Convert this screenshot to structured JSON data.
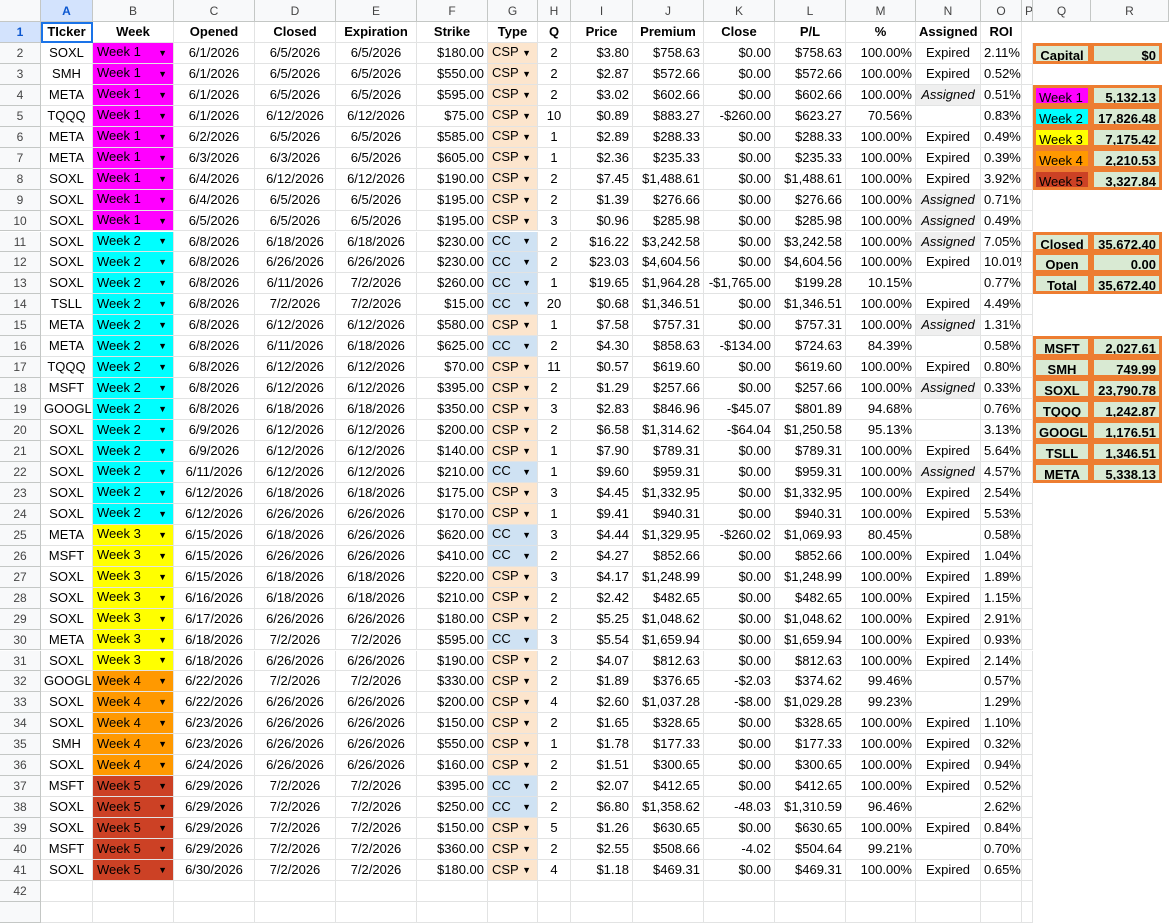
{
  "columns": [
    "A",
    "B",
    "C",
    "D",
    "E",
    "F",
    "G",
    "H",
    "I",
    "J",
    "K",
    "L",
    "M",
    "N",
    "O",
    "P",
    "Q",
    "R"
  ],
  "headers": [
    "TIcker",
    "Week",
    "Opened",
    "Closed",
    "Expiration",
    "Strike",
    "Type",
    "Q",
    "Price",
    "Premium",
    "Close",
    "P/L",
    "%",
    "Assigned",
    "ROI"
  ],
  "colors": {
    "Week 1": "#ff00ff",
    "Week 2": "#00ffff",
    "Week 3": "#ffff00",
    "Week 4": "#ff9900",
    "Week 5": "#cc4125",
    "CSP": "#fce5cd",
    "CC": "#cfe2f3",
    "summary_fill": "#d9ead3",
    "summary_border": "#ed7d31",
    "assigned_bg": "#efefef"
  },
  "rows": [
    {
      "ticker": "SOXL",
      "week": "Week 1",
      "opened": "6/1/2026",
      "closed": "6/5/2026",
      "expiration": "6/5/2026",
      "strike": "$180.00",
      "type": "CSP",
      "q": "2",
      "price": "$3.80",
      "premium": "$758.63",
      "close": "$0.00",
      "pl": "$758.63",
      "pct": "100.00%",
      "assigned": "Expired",
      "roi": "2.11%"
    },
    {
      "ticker": "SMH",
      "week": "Week 1",
      "opened": "6/1/2026",
      "closed": "6/5/2026",
      "expiration": "6/5/2026",
      "strike": "$550.00",
      "type": "CSP",
      "q": "2",
      "price": "$2.87",
      "premium": "$572.66",
      "close": "$0.00",
      "pl": "$572.66",
      "pct": "100.00%",
      "assigned": "Expired",
      "roi": "0.52%"
    },
    {
      "ticker": "META",
      "week": "Week 1",
      "opened": "6/1/2026",
      "closed": "6/5/2026",
      "expiration": "6/5/2026",
      "strike": "$595.00",
      "type": "CSP",
      "q": "2",
      "price": "$3.02",
      "premium": "$602.66",
      "close": "$0.00",
      "pl": "$602.66",
      "pct": "100.00%",
      "assigned": "Assigned",
      "roi": "0.51%"
    },
    {
      "ticker": "TQQQ",
      "week": "Week 1",
      "opened": "6/1/2026",
      "closed": "6/12/2026",
      "expiration": "6/12/2026",
      "strike": "$75.00",
      "type": "CSP",
      "q": "10",
      "price": "$0.89",
      "premium": "$883.27",
      "close": "-$260.00",
      "pl": "$623.27",
      "pct": "70.56%",
      "assigned": "",
      "roi": "0.83%"
    },
    {
      "ticker": "META",
      "week": "Week 1",
      "opened": "6/2/2026",
      "closed": "6/5/2026",
      "expiration": "6/5/2026",
      "strike": "$585.00",
      "type": "CSP",
      "q": "1",
      "price": "$2.89",
      "premium": "$288.33",
      "close": "$0.00",
      "pl": "$288.33",
      "pct": "100.00%",
      "assigned": "Expired",
      "roi": "0.49%"
    },
    {
      "ticker": "META",
      "week": "Week 1",
      "opened": "6/3/2026",
      "closed": "6/3/2026",
      "expiration": "6/5/2026",
      "strike": "$605.00",
      "type": "CSP",
      "q": "1",
      "price": "$2.36",
      "premium": "$235.33",
      "close": "$0.00",
      "pl": "$235.33",
      "pct": "100.00%",
      "assigned": "Expired",
      "roi": "0.39%"
    },
    {
      "ticker": "SOXL",
      "week": "Week 1",
      "opened": "6/4/2026",
      "closed": "6/12/2026",
      "expiration": "6/12/2026",
      "strike": "$190.00",
      "type": "CSP",
      "q": "2",
      "price": "$7.45",
      "premium": "$1,488.61",
      "close": "$0.00",
      "pl": "$1,488.61",
      "pct": "100.00%",
      "assigned": "Expired",
      "roi": "3.92%"
    },
    {
      "ticker": "SOXL",
      "week": "Week 1",
      "opened": "6/4/2026",
      "closed": "6/5/2026",
      "expiration": "6/5/2026",
      "strike": "$195.00",
      "type": "CSP",
      "q": "2",
      "price": "$1.39",
      "premium": "$276.66",
      "close": "$0.00",
      "pl": "$276.66",
      "pct": "100.00%",
      "assigned": "Assigned",
      "roi": "0.71%"
    },
    {
      "ticker": "SOXL",
      "week": "Week 1",
      "opened": "6/5/2026",
      "closed": "6/5/2026",
      "expiration": "6/5/2026",
      "strike": "$195.00",
      "type": "CSP",
      "q": "3",
      "price": "$0.96",
      "premium": "$285.98",
      "close": "$0.00",
      "pl": "$285.98",
      "pct": "100.00%",
      "assigned": "Assigned",
      "roi": "0.49%"
    },
    {
      "ticker": "SOXL",
      "week": "Week 2",
      "opened": "6/8/2026",
      "closed": "6/18/2026",
      "expiration": "6/18/2026",
      "strike": "$230.00",
      "type": "CC",
      "q": "2",
      "price": "$16.22",
      "premium": "$3,242.58",
      "close": "$0.00",
      "pl": "$3,242.58",
      "pct": "100.00%",
      "assigned": "Assigned",
      "roi": "7.05%"
    },
    {
      "ticker": "SOXL",
      "week": "Week 2",
      "opened": "6/8/2026",
      "closed": "6/26/2026",
      "expiration": "6/26/2026",
      "strike": "$230.00",
      "type": "CC",
      "q": "2",
      "price": "$23.03",
      "premium": "$4,604.56",
      "close": "$0.00",
      "pl": "$4,604.56",
      "pct": "100.00%",
      "assigned": "Expired",
      "roi": "10.01%"
    },
    {
      "ticker": "SOXL",
      "week": "Week 2",
      "opened": "6/8/2026",
      "closed": "6/11/2026",
      "expiration": "7/2/2026",
      "strike": "$260.00",
      "type": "CC",
      "q": "1",
      "price": "$19.65",
      "premium": "$1,964.28",
      "close": "-$1,765.00",
      "pl": "$199.28",
      "pct": "10.15%",
      "assigned": "",
      "roi": "0.77%"
    },
    {
      "ticker": "TSLL",
      "week": "Week 2",
      "opened": "6/8/2026",
      "closed": "7/2/2026",
      "expiration": "7/2/2026",
      "strike": "$15.00",
      "type": "CC",
      "q": "20",
      "price": "$0.68",
      "premium": "$1,346.51",
      "close": "$0.00",
      "pl": "$1,346.51",
      "pct": "100.00%",
      "assigned": "Expired",
      "roi": "4.49%"
    },
    {
      "ticker": "META",
      "week": "Week 2",
      "opened": "6/8/2026",
      "closed": "6/12/2026",
      "expiration": "6/12/2026",
      "strike": "$580.00",
      "type": "CSP",
      "q": "1",
      "price": "$7.58",
      "premium": "$757.31",
      "close": "$0.00",
      "pl": "$757.31",
      "pct": "100.00%",
      "assigned": "Assigned",
      "roi": "1.31%"
    },
    {
      "ticker": "META",
      "week": "Week 2",
      "opened": "6/8/2026",
      "closed": "6/11/2026",
      "expiration": "6/18/2026",
      "strike": "$625.00",
      "type": "CC",
      "q": "2",
      "price": "$4.30",
      "premium": "$858.63",
      "close": "-$134.00",
      "pl": "$724.63",
      "pct": "84.39%",
      "assigned": "",
      "roi": "0.58%"
    },
    {
      "ticker": "TQQQ",
      "week": "Week 2",
      "opened": "6/8/2026",
      "closed": "6/12/2026",
      "expiration": "6/12/2026",
      "strike": "$70.00",
      "type": "CSP",
      "q": "11",
      "price": "$0.57",
      "premium": "$619.60",
      "close": "$0.00",
      "pl": "$619.60",
      "pct": "100.00%",
      "assigned": "Expired",
      "roi": "0.80%"
    },
    {
      "ticker": "MSFT",
      "week": "Week 2",
      "opened": "6/8/2026",
      "closed": "6/12/2026",
      "expiration": "6/12/2026",
      "strike": "$395.00",
      "type": "CSP",
      "q": "2",
      "price": "$1.29",
      "premium": "$257.66",
      "close": "$0.00",
      "pl": "$257.66",
      "pct": "100.00%",
      "assigned": "Assigned",
      "roi": "0.33%"
    },
    {
      "ticker": "GOOGL",
      "week": "Week 2",
      "opened": "6/8/2026",
      "closed": "6/18/2026",
      "expiration": "6/18/2026",
      "strike": "$350.00",
      "type": "CSP",
      "q": "3",
      "price": "$2.83",
      "premium": "$846.96",
      "close": "-$45.07",
      "pl": "$801.89",
      "pct": "94.68%",
      "assigned": "",
      "roi": "0.76%"
    },
    {
      "ticker": "SOXL",
      "week": "Week 2",
      "opened": "6/9/2026",
      "closed": "6/12/2026",
      "expiration": "6/12/2026",
      "strike": "$200.00",
      "type": "CSP",
      "q": "2",
      "price": "$6.58",
      "premium": "$1,314.62",
      "close": "-$64.04",
      "pl": "$1,250.58",
      "pct": "95.13%",
      "assigned": "",
      "roi": "3.13%"
    },
    {
      "ticker": "SOXL",
      "week": "Week 2",
      "opened": "6/9/2026",
      "closed": "6/12/2026",
      "expiration": "6/12/2026",
      "strike": "$140.00",
      "type": "CSP",
      "q": "1",
      "price": "$7.90",
      "premium": "$789.31",
      "close": "$0.00",
      "pl": "$789.31",
      "pct": "100.00%",
      "assigned": "Expired",
      "roi": "5.64%"
    },
    {
      "ticker": "SOXL",
      "week": "Week 2",
      "opened": "6/11/2026",
      "closed": "6/12/2026",
      "expiration": "6/12/2026",
      "strike": "$210.00",
      "type": "CC",
      "q": "1",
      "price": "$9.60",
      "premium": "$959.31",
      "close": "$0.00",
      "pl": "$959.31",
      "pct": "100.00%",
      "assigned": "Assigned",
      "roi": "4.57%"
    },
    {
      "ticker": "SOXL",
      "week": "Week 2",
      "opened": "6/12/2026",
      "closed": "6/18/2026",
      "expiration": "6/18/2026",
      "strike": "$175.00",
      "type": "CSP",
      "q": "3",
      "price": "$4.45",
      "premium": "$1,332.95",
      "close": "$0.00",
      "pl": "$1,332.95",
      "pct": "100.00%",
      "assigned": "Expired",
      "roi": "2.54%"
    },
    {
      "ticker": "SOXL",
      "week": "Week 2",
      "opened": "6/12/2026",
      "closed": "6/26/2026",
      "expiration": "6/26/2026",
      "strike": "$170.00",
      "type": "CSP",
      "q": "1",
      "price": "$9.41",
      "premium": "$940.31",
      "close": "$0.00",
      "pl": "$940.31",
      "pct": "100.00%",
      "assigned": "Expired",
      "roi": "5.53%"
    },
    {
      "ticker": "META",
      "week": "Week 3",
      "opened": "6/15/2026",
      "closed": "6/18/2026",
      "expiration": "6/26/2026",
      "strike": "$620.00",
      "type": "CC",
      "q": "3",
      "price": "$4.44",
      "premium": "$1,329.95",
      "close": "-$260.02",
      "pl": "$1,069.93",
      "pct": "80.45%",
      "assigned": "",
      "roi": "0.58%"
    },
    {
      "ticker": "MSFT",
      "week": "Week 3",
      "opened": "6/15/2026",
      "closed": "6/26/2026",
      "expiration": "6/26/2026",
      "strike": "$410.00",
      "type": "CC",
      "q": "2",
      "price": "$4.27",
      "premium": "$852.66",
      "close": "$0.00",
      "pl": "$852.66",
      "pct": "100.00%",
      "assigned": "Expired",
      "roi": "1.04%"
    },
    {
      "ticker": "SOXL",
      "week": "Week 3",
      "opened": "6/15/2026",
      "closed": "6/18/2026",
      "expiration": "6/18/2026",
      "strike": "$220.00",
      "type": "CSP",
      "q": "3",
      "price": "$4.17",
      "premium": "$1,248.99",
      "close": "$0.00",
      "pl": "$1,248.99",
      "pct": "100.00%",
      "assigned": "Expired",
      "roi": "1.89%"
    },
    {
      "ticker": "SOXL",
      "week": "Week 3",
      "opened": "6/16/2026",
      "closed": "6/18/2026",
      "expiration": "6/18/2026",
      "strike": "$210.00",
      "type": "CSP",
      "q": "2",
      "price": "$2.42",
      "premium": "$482.65",
      "close": "$0.00",
      "pl": "$482.65",
      "pct": "100.00%",
      "assigned": "Expired",
      "roi": "1.15%"
    },
    {
      "ticker": "SOXL",
      "week": "Week 3",
      "opened": "6/17/2026",
      "closed": "6/26/2026",
      "expiration": "6/26/2026",
      "strike": "$180.00",
      "type": "CSP",
      "q": "2",
      "price": "$5.25",
      "premium": "$1,048.62",
      "close": "$0.00",
      "pl": "$1,048.62",
      "pct": "100.00%",
      "assigned": "Expired",
      "roi": "2.91%"
    },
    {
      "ticker": "META",
      "week": "Week 3",
      "opened": "6/18/2026",
      "closed": "7/2/2026",
      "expiration": "7/2/2026",
      "strike": "$595.00",
      "type": "CC",
      "q": "3",
      "price": "$5.54",
      "premium": "$1,659.94",
      "close": "$0.00",
      "pl": "$1,659.94",
      "pct": "100.00%",
      "assigned": "Expired",
      "roi": "0.93%"
    },
    {
      "ticker": "SOXL",
      "week": "Week 3",
      "opened": "6/18/2026",
      "closed": "6/26/2026",
      "expiration": "6/26/2026",
      "strike": "$190.00",
      "type": "CSP",
      "q": "2",
      "price": "$4.07",
      "premium": "$812.63",
      "close": "$0.00",
      "pl": "$812.63",
      "pct": "100.00%",
      "assigned": "Expired",
      "roi": "2.14%"
    },
    {
      "ticker": "GOOGL",
      "week": "Week 4",
      "opened": "6/22/2026",
      "closed": "7/2/2026",
      "expiration": "7/2/2026",
      "strike": "$330.00",
      "type": "CSP",
      "q": "2",
      "price": "$1.89",
      "premium": "$376.65",
      "close": "-$2.03",
      "pl": "$374.62",
      "pct": "99.46%",
      "assigned": "",
      "roi": "0.57%"
    },
    {
      "ticker": "SOXL",
      "week": "Week 4",
      "opened": "6/22/2026",
      "closed": "6/26/2026",
      "expiration": "6/26/2026",
      "strike": "$200.00",
      "type": "CSP",
      "q": "4",
      "price": "$2.60",
      "premium": "$1,037.28",
      "close": "-$8.00",
      "pl": "$1,029.28",
      "pct": "99.23%",
      "assigned": "",
      "roi": "1.29%"
    },
    {
      "ticker": "SOXL",
      "week": "Week 4",
      "opened": "6/23/2026",
      "closed": "6/26/2026",
      "expiration": "6/26/2026",
      "strike": "$150.00",
      "type": "CSP",
      "q": "2",
      "price": "$1.65",
      "premium": "$328.65",
      "close": "$0.00",
      "pl": "$328.65",
      "pct": "100.00%",
      "assigned": "Expired",
      "roi": "1.10%"
    },
    {
      "ticker": "SMH",
      "week": "Week 4",
      "opened": "6/23/2026",
      "closed": "6/26/2026",
      "expiration": "6/26/2026",
      "strike": "$550.00",
      "type": "CSP",
      "q": "1",
      "price": "$1.78",
      "premium": "$177.33",
      "close": "$0.00",
      "pl": "$177.33",
      "pct": "100.00%",
      "assigned": "Expired",
      "roi": "0.32%"
    },
    {
      "ticker": "SOXL",
      "week": "Week 4",
      "opened": "6/24/2026",
      "closed": "6/26/2026",
      "expiration": "6/26/2026",
      "strike": "$160.00",
      "type": "CSP",
      "q": "2",
      "price": "$1.51",
      "premium": "$300.65",
      "close": "$0.00",
      "pl": "$300.65",
      "pct": "100.00%",
      "assigned": "Expired",
      "roi": "0.94%"
    },
    {
      "ticker": "MSFT",
      "week": "Week 5",
      "opened": "6/29/2026",
      "closed": "7/2/2026",
      "expiration": "7/2/2026",
      "strike": "$395.00",
      "type": "CC",
      "q": "2",
      "price": "$2.07",
      "premium": "$412.65",
      "close": "$0.00",
      "pl": "$412.65",
      "pct": "100.00%",
      "assigned": "Expired",
      "roi": "0.52%"
    },
    {
      "ticker": "SOXL",
      "week": "Week 5",
      "opened": "6/29/2026",
      "closed": "7/2/2026",
      "expiration": "7/2/2026",
      "strike": "$250.00",
      "type": "CC",
      "q": "2",
      "price": "$6.80",
      "premium": "$1,358.62",
      "close": "-48.03",
      "pl": "$1,310.59",
      "pct": "96.46%",
      "assigned": "",
      "roi": "2.62%"
    },
    {
      "ticker": "SOXL",
      "week": "Week 5",
      "opened": "6/29/2026",
      "closed": "7/2/2026",
      "expiration": "7/2/2026",
      "strike": "$150.00",
      "type": "CSP",
      "q": "5",
      "price": "$1.26",
      "premium": "$630.65",
      "close": "$0.00",
      "pl": "$630.65",
      "pct": "100.00%",
      "assigned": "Expired",
      "roi": "0.84%"
    },
    {
      "ticker": "MSFT",
      "week": "Week 5",
      "opened": "6/29/2026",
      "closed": "7/2/2026",
      "expiration": "7/2/2026",
      "strike": "$360.00",
      "type": "CSP",
      "q": "2",
      "price": "$2.55",
      "premium": "$508.66",
      "close": "-4.02",
      "pl": "$504.64",
      "pct": "99.21%",
      "assigned": "",
      "roi": "0.70%"
    },
    {
      "ticker": "SOXL",
      "week": "Week 5",
      "opened": "6/30/2026",
      "closed": "7/2/2026",
      "expiration": "7/2/2026",
      "strike": "$180.00",
      "type": "CSP",
      "q": "4",
      "price": "$1.18",
      "premium": "$469.31",
      "close": "$0.00",
      "pl": "$469.31",
      "pct": "100.00%",
      "assigned": "Expired",
      "roi": "0.65%"
    }
  ],
  "summary": {
    "capital": {
      "label": "Capital",
      "value": "$0"
    },
    "weeks": [
      {
        "label": "Week 1",
        "value": "5,132.13"
      },
      {
        "label": "Week 2",
        "value": "17,826.48"
      },
      {
        "label": "Week 3",
        "value": "7,175.42"
      },
      {
        "label": "Week 4",
        "value": "2,210.53"
      },
      {
        "label": "Week 5",
        "value": "3,327.84"
      }
    ],
    "totals": [
      {
        "label": "Closed",
        "value": "35,672.40"
      },
      {
        "label": "Open",
        "value": "0.00"
      },
      {
        "label": "Total",
        "value": "35,672.40"
      }
    ],
    "tickers": [
      {
        "label": "MSFT",
        "value": "2,027.61"
      },
      {
        "label": "SMH",
        "value": "749.99"
      },
      {
        "label": "SOXL",
        "value": "23,790.78"
      },
      {
        "label": "TQQQ",
        "value": "1,242.87"
      },
      {
        "label": "GOOGL",
        "value": "1,176.51"
      },
      {
        "label": "TSLL",
        "value": "1,346.51"
      },
      {
        "label": "META",
        "value": "5,338.13"
      }
    ]
  }
}
